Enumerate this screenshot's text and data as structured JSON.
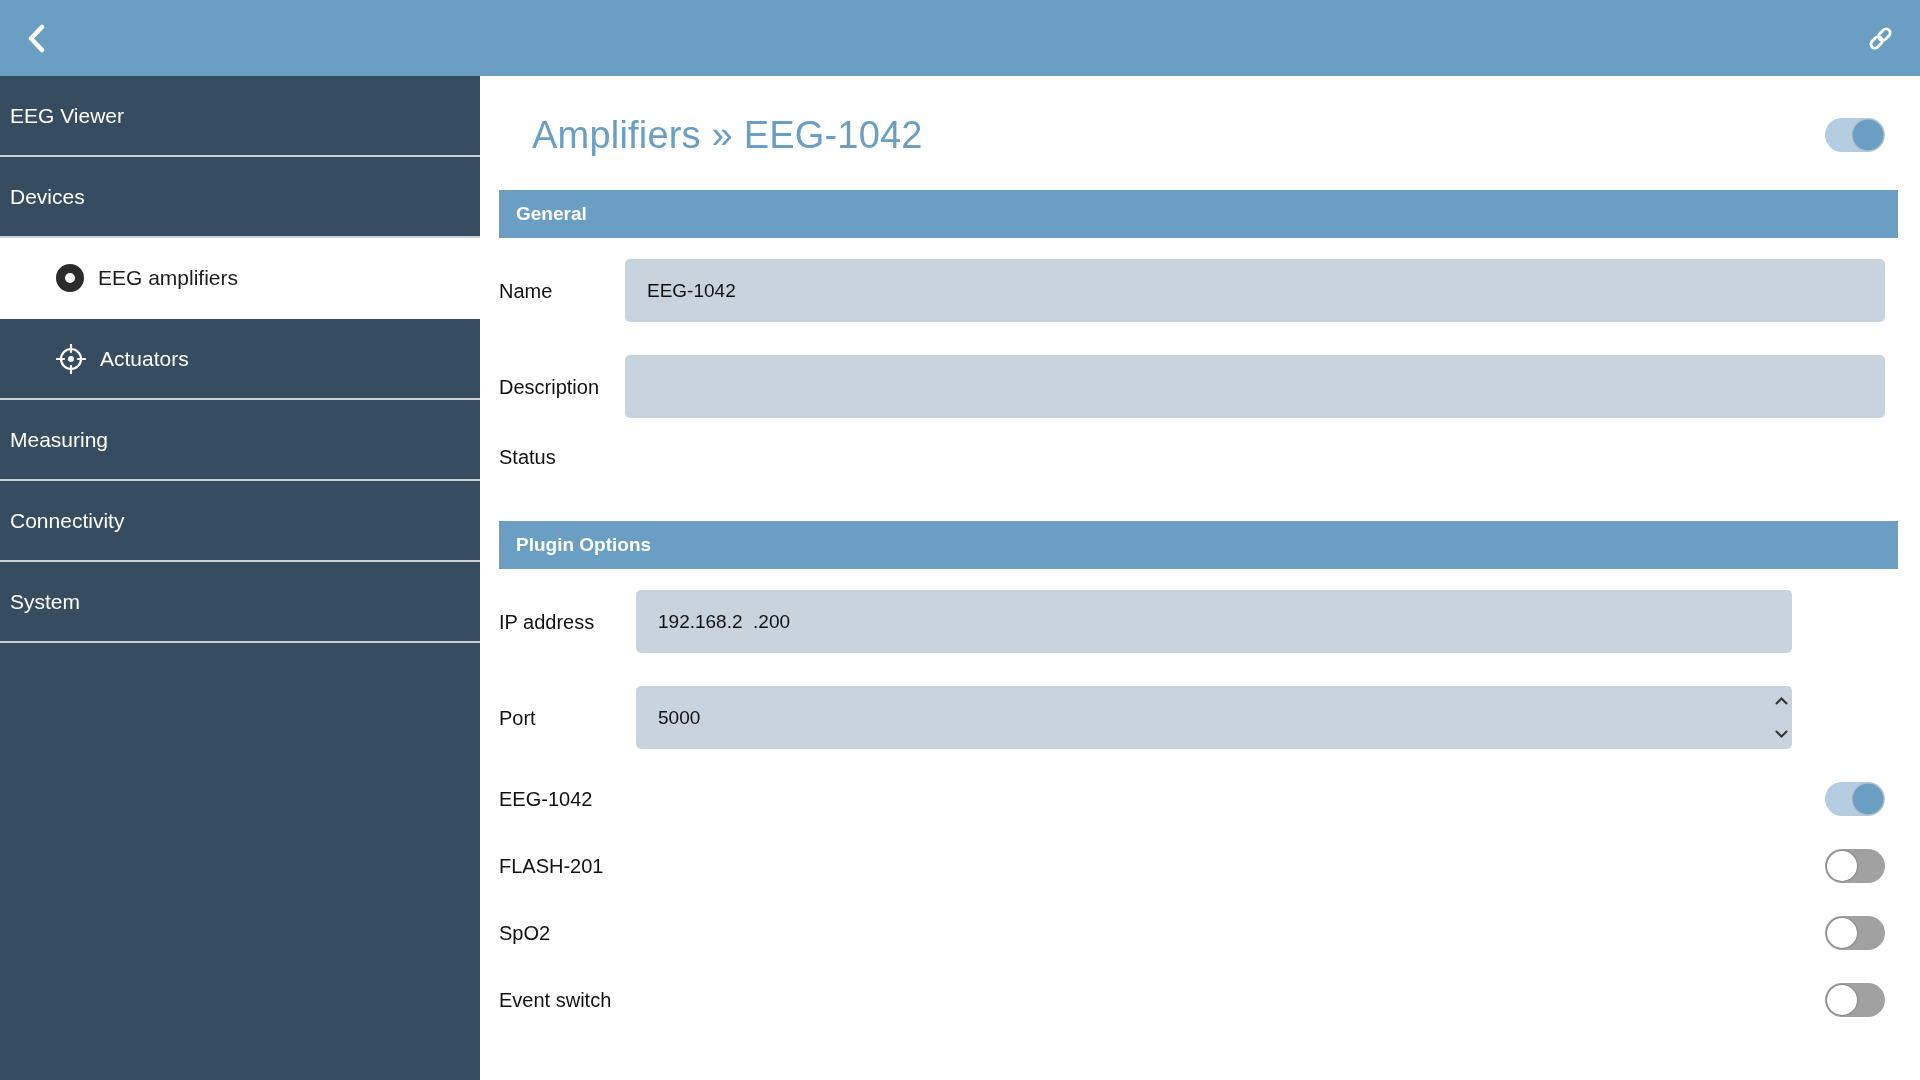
{
  "sidebar": {
    "items": [
      {
        "label": "EEG Viewer",
        "selected": false
      },
      {
        "label": "Devices",
        "selected": false,
        "children": [
          {
            "label": "EEG amplifiers",
            "selected": true
          },
          {
            "label": "Actuators",
            "selected": false
          }
        ]
      },
      {
        "label": "Measuring",
        "selected": false
      },
      {
        "label": "Connectivity",
        "selected": false
      },
      {
        "label": "System",
        "selected": false
      }
    ]
  },
  "page": {
    "title": "Amplifiers » EEG-1042",
    "on": true
  },
  "sections": [
    {
      "title": "General",
      "fields": [
        {
          "kind": "text",
          "label": "Name",
          "value": "EEG-1042"
        },
        {
          "kind": "text",
          "label": "Description"
        },
        {
          "kind": "static",
          "label": "Status"
        }
      ]
    },
    {
      "title": "Plugin Options",
      "fields": [
        {
          "kind": "text",
          "label": "IP address",
          "value": "192.168.2  .200"
        },
        {
          "kind": "number",
          "label": "Port",
          "value": "5000"
        },
        {
          "kind": "switch",
          "label": "EEG-1042",
          "on": true
        },
        {
          "kind": "switch",
          "label": "FLASH-201",
          "on": false
        },
        {
          "kind": "switch",
          "label": "SpO2",
          "on": false
        },
        {
          "kind": "switch",
          "label": "Event switch",
          "on": false
        }
      ]
    }
  ]
}
